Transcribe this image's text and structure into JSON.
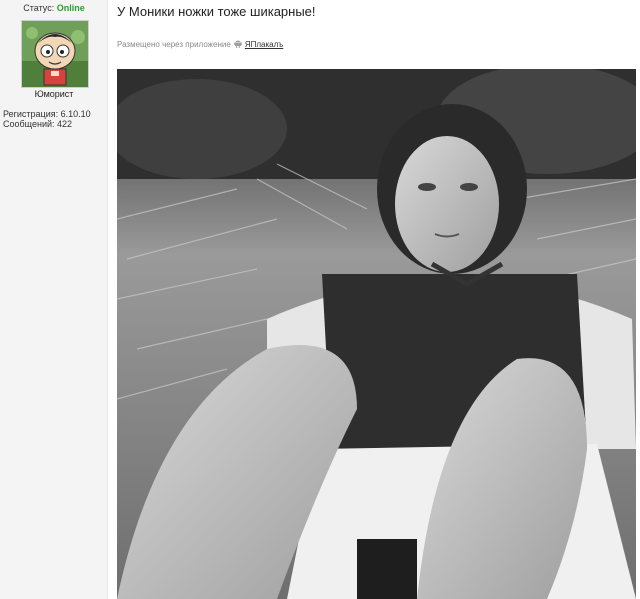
{
  "user": {
    "status_label": "Статус:",
    "status_value": "Online",
    "username": "Юморист",
    "registration": "Регистрация: 6.10.10",
    "messages": "Сообщений: 422"
  },
  "post": {
    "title": "У Моники ножки тоже шикарные!",
    "posted_via": "Размещено через приложение",
    "app_name": "ЯПлакалъ"
  },
  "colors": {
    "status_online": "#2a9d2a",
    "panel_bg": "#f4f4f4"
  }
}
